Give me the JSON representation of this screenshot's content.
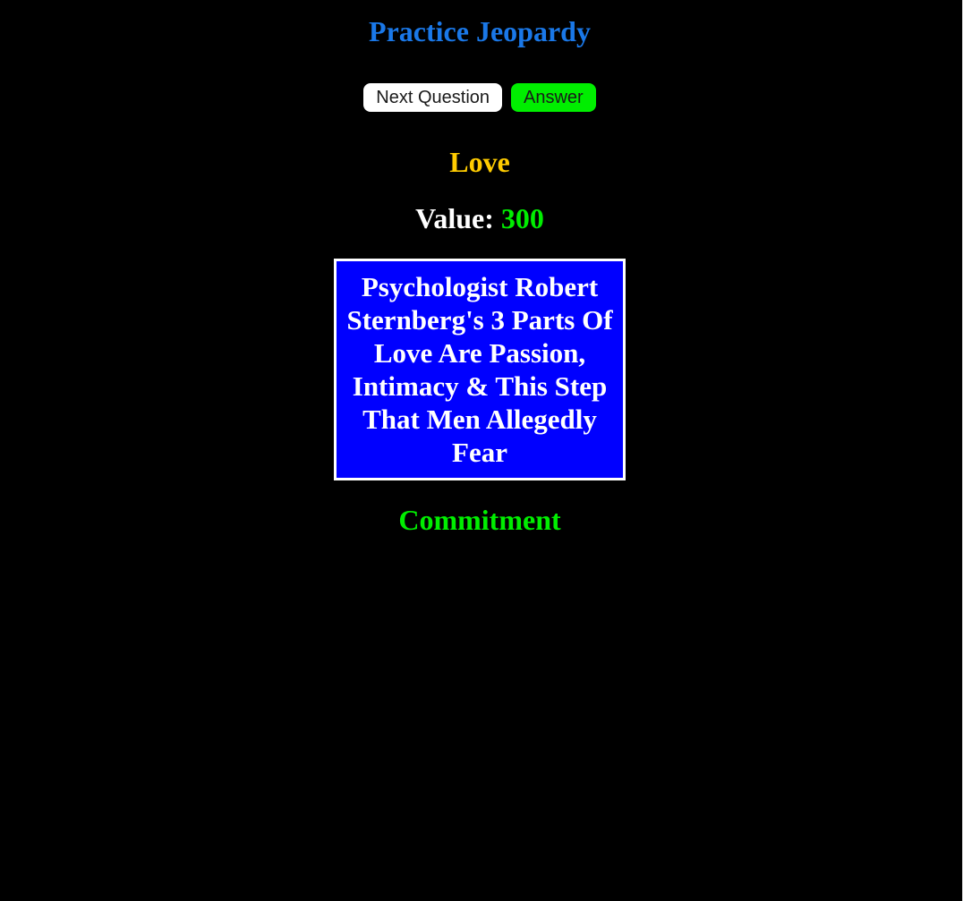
{
  "page": {
    "title": "Practice Jeopardy"
  },
  "buttons": {
    "next_question": "Next Question",
    "answer": "Answer"
  },
  "question": {
    "category": "Love",
    "value_label": "Value:",
    "value": "300",
    "clue": "Psychologist Robert Sternberg's 3 Parts Of Love Are Passion, Intimacy & This Step That Men Allegedly Fear",
    "answer": "Commitment"
  },
  "colors": {
    "background": "#000000",
    "title": "#1a78e8",
    "category": "#ffcc00",
    "value": "#00ee00",
    "answer": "#00ee00",
    "clue_background": "#0000ff",
    "next_button_bg": "#ffffff",
    "answer_button_bg": "#00ee00"
  }
}
